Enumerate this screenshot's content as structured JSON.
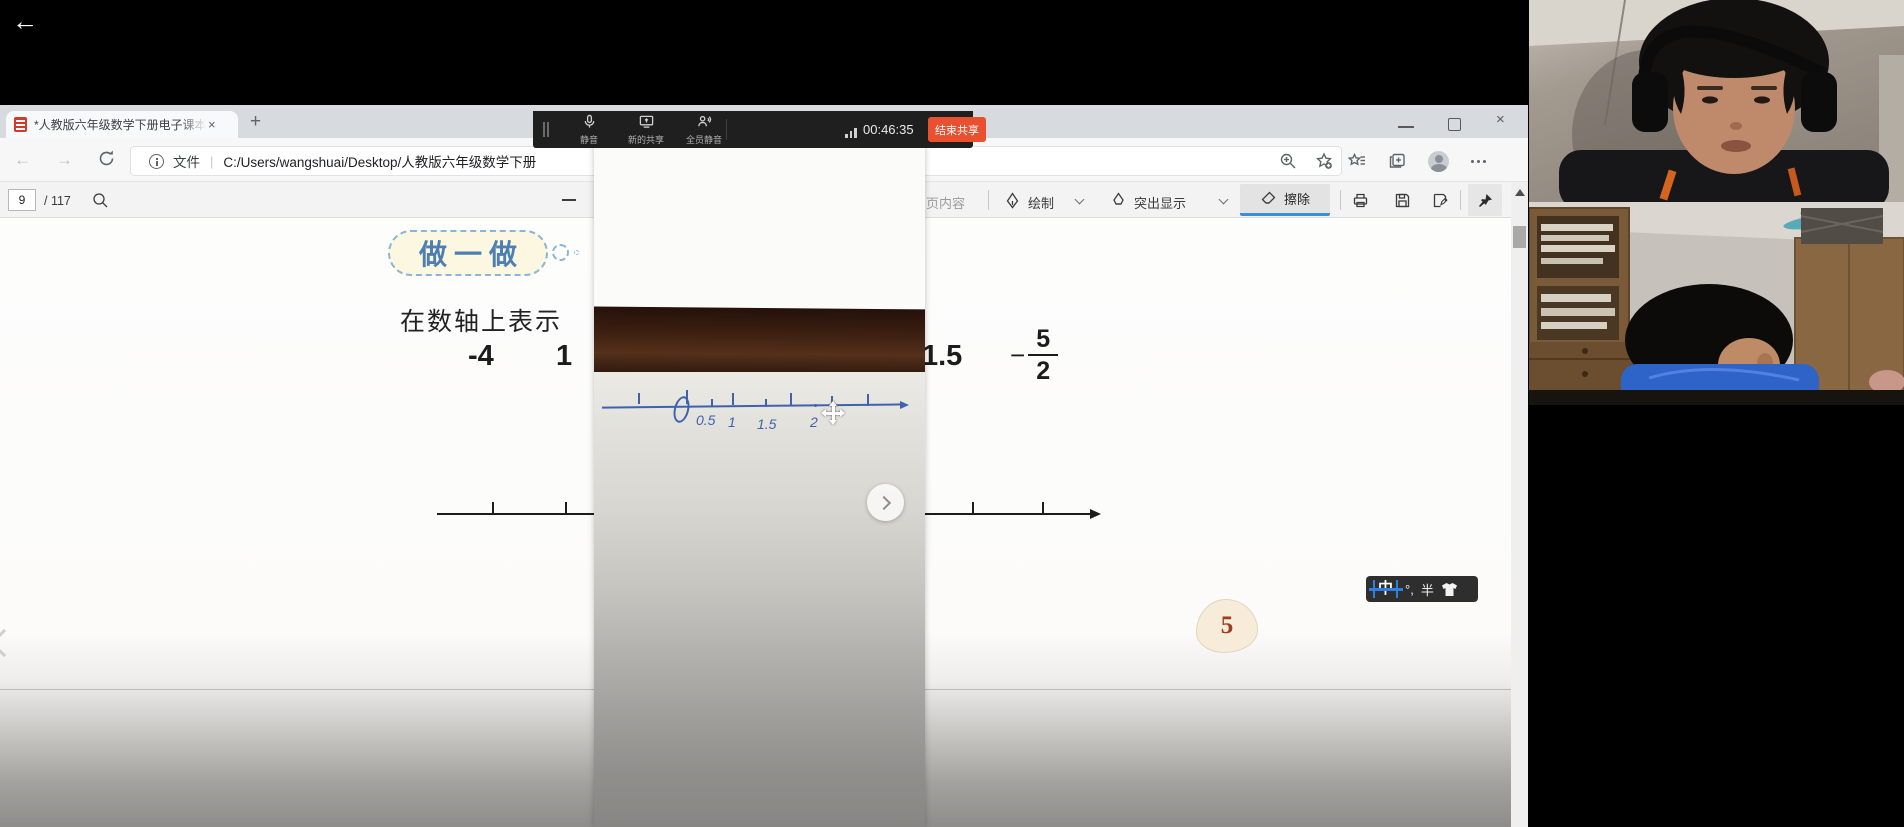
{
  "system": {
    "back": "←"
  },
  "browser": {
    "tab": {
      "title": "*人教版六年级数学下册电子课本",
      "close": "×"
    },
    "new_tab": "+",
    "window_controls": {
      "close": "×"
    },
    "nav": {
      "back": "←",
      "forward": "→"
    },
    "address": {
      "scheme_label": "文件",
      "divider": "|",
      "url": "C:/Users/wangshuai/Desktop/人教版六年级数学下册"
    }
  },
  "pdf_toolbar": {
    "page_input": "9",
    "page_total": "/ 117",
    "read_aloud_partial": "页内容",
    "draw_label": "绘制",
    "highlight_label": "突出显示",
    "erase_label": "擦除"
  },
  "meeting": {
    "mute_label": "静音",
    "new_share_label": "新的共享",
    "mute_all_label": "全员静音",
    "timer": "00:46:35",
    "end_share_label": "结束共享"
  },
  "textbook": {
    "badge_label": "做一做",
    "prompt": "在数轴上表示",
    "numbers": {
      "n1": "-4",
      "n2": "1",
      "n3": "1.5"
    },
    "fraction": {
      "sign": "−",
      "numerator": "5",
      "denominator": "2"
    },
    "page_number": "5"
  },
  "whiteboard": {
    "origin": "0",
    "labels": {
      "l1": "0.5",
      "l2": "1",
      "l3": "1.5",
      "l4": "2"
    }
  },
  "ime": {
    "lang_mode": "中",
    "punctuation": "°,",
    "char_width": "半"
  },
  "colors": {
    "end_share_button": "#e8502f",
    "erase_active_underline": "#3f8cda",
    "meeting_toolbar_bg": "#1f1f1f",
    "handwriting_ink": "#3f62ac",
    "pdf_icon_red": "#d23b2c"
  },
  "icons": {
    "back_arrow": "←",
    "search": "magnifier",
    "zoom_out": "minus",
    "draw": "pen-nib",
    "highlight": "highlighter",
    "erase": "eraser",
    "print": "printer",
    "save": "floppy",
    "save_as": "floppy-pen",
    "pin": "pushpin",
    "mic": "microphone",
    "share": "screen",
    "mute_all": "people-mute",
    "signal": "bars",
    "move_cursor": "four-arrows",
    "ime_skin": "t-shirt"
  }
}
